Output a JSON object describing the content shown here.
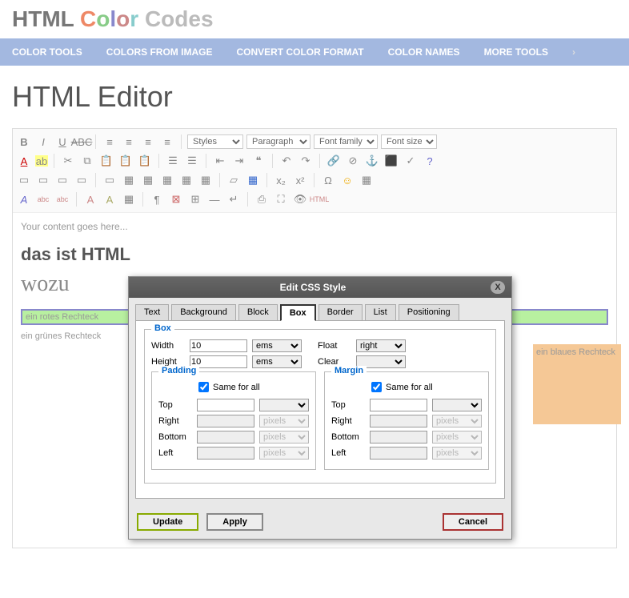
{
  "logo": {
    "html": "HTML",
    "color": "Color",
    "codes": "Codes"
  },
  "nav": [
    "COLOR TOOLS",
    "COLORS FROM IMAGE",
    "CONVERT COLOR FORMAT",
    "COLOR NAMES",
    "MORE TOOLS"
  ],
  "page_title": "HTML Editor",
  "editor": {
    "selects": {
      "styles": "Styles",
      "paragraph": "Paragraph",
      "font_family": "Font family",
      "font_size": "Font size"
    },
    "placeholder": "Your content goes here...",
    "heading": "das ist HTML",
    "wozu": "wozu",
    "red": "ein rotes Rechteck",
    "green": "ein grünes Rechteck",
    "blue": "ein blaues Rechteck"
  },
  "dialog": {
    "title": "Edit CSS Style",
    "tabs": [
      "Text",
      "Background",
      "Block",
      "Box",
      "Border",
      "List",
      "Positioning"
    ],
    "active_tab": "Box",
    "box": {
      "legend": "Box",
      "width_label": "Width",
      "width_value": "10",
      "width_unit": "ems",
      "height_label": "Height",
      "height_value": "10",
      "height_unit": "ems",
      "float_label": "Float",
      "float_value": "right",
      "clear_label": "Clear",
      "clear_value": ""
    },
    "padding": {
      "legend": "Padding",
      "same": "Same for all",
      "same_checked": true,
      "top": "Top",
      "right": "Right",
      "bottom": "Bottom",
      "left": "Left",
      "unit": "pixels"
    },
    "margin": {
      "legend": "Margin",
      "same": "Same for all",
      "same_checked": true,
      "top": "Top",
      "right": "Right",
      "bottom": "Bottom",
      "left": "Left",
      "unit": "pixels"
    },
    "buttons": {
      "update": "Update",
      "apply": "Apply",
      "cancel": "Cancel"
    }
  }
}
